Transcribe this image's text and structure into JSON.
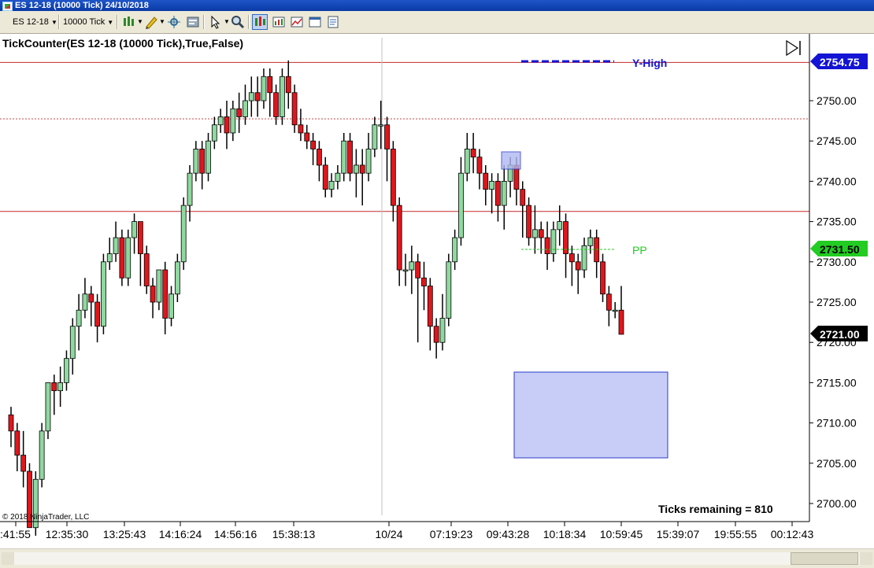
{
  "window": {
    "title": "ES 12-18 (10000 Tick)  24/10/2018"
  },
  "toolbar": {
    "instrument": "ES 12-18",
    "interval": "10000 Tick",
    "icons": [
      "bar-style-icon",
      "pencil-draw-icon",
      "crosshair-icon",
      "properties-icon",
      "arrow-pointer-icon",
      "zoom-icon",
      "chart-type-icon",
      "indicators-icon",
      "strategies-icon",
      "data-box-icon"
    ]
  },
  "chart": {
    "indicator_label": "TickCounter(ES 12-18 (10000 Tick),True,False)",
    "copyright": "© 2018 NinjaTrader, LLC",
    "ticks_remaining": "Ticks remaining = 810",
    "y_high_label": "Y-High",
    "pp_label": "PP",
    "price_labels": {
      "y_high": "2754.75",
      "pp": "2731.50",
      "last": "2721.00"
    },
    "colors": {
      "up": "#8fd89f",
      "down": "#e0161c",
      "y_high": "#1414d4",
      "pp": "#22cc22",
      "hline": "#c62828",
      "box": "#c8cdf7",
      "box_border": "#2a3ac8"
    },
    "y_ticks": [
      "2750.00",
      "2745.00",
      "2740.00",
      "2735.00",
      "2730.00",
      "2725.00",
      "2720.00",
      "2715.00",
      "2710.00",
      "2705.00",
      "2700.00"
    ],
    "x_ticks": [
      ":41:55",
      "12:35:30",
      "13:25:43",
      "14:16:24",
      "14:56:16",
      "15:38:13",
      "10/24",
      "07:19:23",
      "09:43:28",
      "10:18:34",
      "10:59:45",
      "15:39:07",
      "19:55:55",
      "00:12:43"
    ]
  },
  "chart_data": {
    "type": "candlestick",
    "title": "TickCounter(ES 12-18 (10000 Tick),True,False)",
    "ylim": [
      2699,
      2756
    ],
    "levels": [
      {
        "name": "Y-High",
        "value": 2754.75
      },
      {
        "name": "PP",
        "value": 2731.5
      },
      {
        "name": "",
        "value": 2747.75
      },
      {
        "name": "",
        "value": 2736.25
      }
    ],
    "last_price": 2721.0,
    "candles": [
      [
        2711,
        2709,
        2712,
        2707
      ],
      [
        2709,
        2706,
        2710,
        2704
      ],
      [
        2706,
        2704,
        2709,
        2702
      ],
      [
        2704,
        2697,
        2705,
        2701
      ],
      [
        2697,
        2703,
        2704,
        2696
      ],
      [
        2703,
        2709,
        2710,
        2702
      ],
      [
        2709,
        2715,
        2715,
        2708
      ],
      [
        2715,
        2714,
        2716,
        2711
      ],
      [
        2714,
        2715,
        2717,
        2712
      ],
      [
        2715,
        2718,
        2719,
        2714
      ],
      [
        2718,
        2722,
        2723,
        2716
      ],
      [
        2722,
        2724,
        2726,
        2719
      ],
      [
        2724,
        2726,
        2728,
        2723
      ],
      [
        2726,
        2725,
        2727,
        2722
      ],
      [
        2725,
        2722,
        2726,
        2720
      ],
      [
        2722,
        2730,
        2731,
        2721
      ],
      [
        2730,
        2731,
        2733,
        2729
      ],
      [
        2731,
        2733,
        2735,
        2730
      ],
      [
        2733,
        2728,
        2734,
        2727
      ],
      [
        2728,
        2733,
        2734,
        2727
      ],
      [
        2733,
        2735,
        2736,
        2731
      ],
      [
        2735,
        2731,
        2735,
        2727
      ],
      [
        2731,
        2727,
        2732,
        2726
      ],
      [
        2727,
        2725,
        2728,
        2723
      ],
      [
        2725,
        2729,
        2729,
        2724
      ],
      [
        2729,
        2723,
        2730,
        2721
      ],
      [
        2723,
        2726,
        2727,
        2722
      ],
      [
        2726,
        2730,
        2731,
        2725
      ],
      [
        2730,
        2737,
        2738,
        2729
      ],
      [
        2737,
        2741,
        2742,
        2735
      ],
      [
        2741,
        2744,
        2745,
        2740
      ],
      [
        2744,
        2741,
        2745,
        2739
      ],
      [
        2741,
        2745,
        2746,
        2740
      ],
      [
        2745,
        2747,
        2748,
        2744
      ],
      [
        2747,
        2748,
        2749,
        2746
      ],
      [
        2748,
        2746,
        2750,
        2744
      ],
      [
        2746,
        2749,
        2750,
        2745
      ],
      [
        2749,
        2748,
        2751,
        2746
      ],
      [
        2748,
        2750,
        2752,
        2747
      ],
      [
        2750,
        2751,
        2753,
        2748
      ],
      [
        2751,
        2750,
        2753,
        2748
      ],
      [
        2750,
        2753,
        2754,
        2749
      ],
      [
        2753,
        2751,
        2754,
        2748
      ],
      [
        2751,
        2748,
        2752,
        2747
      ],
      [
        2748,
        2753,
        2754,
        2747
      ],
      [
        2753,
        2751,
        2755,
        2749
      ],
      [
        2751,
        2747,
        2752,
        2746
      ],
      [
        2747,
        2746,
        2749,
        2745
      ],
      [
        2746,
        2745,
        2747,
        2744
      ],
      [
        2745,
        2744,
        2746,
        2742
      ],
      [
        2744,
        2742,
        2745,
        2740
      ],
      [
        2742,
        2739,
        2743,
        2738
      ],
      [
        2739,
        2740,
        2741,
        2738
      ],
      [
        2740,
        2741,
        2742,
        2739
      ],
      [
        2741,
        2745,
        2746,
        2740
      ],
      [
        2745,
        2741,
        2746,
        2740
      ],
      [
        2741,
        2742,
        2744,
        2738
      ],
      [
        2742,
        2741,
        2744,
        2737
      ],
      [
        2741,
        2744,
        2746,
        2740
      ],
      [
        2744,
        2747,
        2748,
        2743
      ],
      [
        2747,
        2747,
        2750,
        2744
      ],
      [
        2747,
        2744,
        2748,
        2740
      ],
      [
        2744,
        2737,
        2745,
        2735
      ],
      [
        2737,
        2729,
        2738,
        2727
      ],
      [
        2729,
        2729,
        2731,
        2727
      ],
      [
        2729,
        2730,
        2732,
        2726
      ],
      [
        2730,
        2728,
        2731,
        2720
      ],
      [
        2728,
        2727,
        2730,
        2724
      ],
      [
        2727,
        2722,
        2728,
        2719
      ],
      [
        2722,
        2720,
        2723,
        2718
      ],
      [
        2720,
        2723,
        2726,
        2719
      ],
      [
        2723,
        2730,
        2731,
        2722
      ],
      [
        2730,
        2733,
        2734,
        2729
      ],
      [
        2733,
        2741,
        2743,
        2732
      ],
      [
        2741,
        2744,
        2746,
        2740
      ],
      [
        2744,
        2743,
        2746,
        2741
      ],
      [
        2743,
        2741,
        2744,
        2739
      ],
      [
        2741,
        2739,
        2742,
        2737
      ],
      [
        2739,
        2740,
        2741,
        2736
      ],
      [
        2740,
        2737,
        2741,
        2735
      ],
      [
        2737,
        2740,
        2742,
        2734
      ],
      [
        2740,
        2742,
        2743,
        2738
      ],
      [
        2742,
        2739,
        2743,
        2737
      ],
      [
        2739,
        2737,
        2740,
        2733
      ],
      [
        2737,
        2733,
        2738,
        2732
      ],
      [
        2733,
        2734,
        2737,
        2731
      ],
      [
        2734,
        2733,
        2735,
        2731
      ],
      [
        2733,
        2731,
        2735,
        2729
      ],
      [
        2731,
        2734,
        2735,
        2730
      ],
      [
        2734,
        2735,
        2737,
        2732
      ],
      [
        2735,
        2731,
        2736,
        2728
      ],
      [
        2731,
        2730,
        2732,
        2727
      ],
      [
        2730,
        2729,
        2731,
        2726
      ],
      [
        2729,
        2732,
        2733,
        2728
      ],
      [
        2732,
        2733,
        2734,
        2731
      ],
      [
        2733,
        2730,
        2734,
        2728
      ],
      [
        2730,
        2726,
        2731,
        2725
      ],
      [
        2726,
        2724,
        2727,
        2722
      ],
      [
        2724,
        2724,
        2725,
        2723
      ],
      [
        2724,
        2721,
        2727,
        2721
      ]
    ],
    "candle_format": [
      "open",
      "close",
      "high",
      "low"
    ]
  }
}
